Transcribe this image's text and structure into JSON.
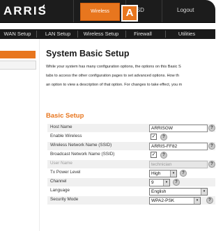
{
  "brand": {
    "logo": "ARRIS"
  },
  "top_nav": {
    "items": [
      {
        "label": "Wireless"
      },
      {
        "label": "HSD"
      },
      {
        "label": "Logout"
      }
    ],
    "active": "Wireless",
    "callout": "A"
  },
  "sub_nav": {
    "items": [
      {
        "label": "WAN Setup"
      },
      {
        "label": "LAN Setup"
      },
      {
        "label": "Wireless Setup"
      },
      {
        "label": "Firewall"
      },
      {
        "label": "Utilities"
      }
    ]
  },
  "page": {
    "title": "System Basic Setup",
    "description": [
      "While your system has many configuration options, the options on this Basic S",
      "tabs to access the other configuration pages to set advanced options. How th",
      "an option to view a description of that option. For changes to take effect, you m"
    ],
    "section": "Basic Setup"
  },
  "form": {
    "host_name": {
      "label": "Host Name",
      "value": "ARRISGW"
    },
    "enable_wireless": {
      "label": "Enable Wireless",
      "checked": true,
      "mark": "✓"
    },
    "ssid": {
      "label": "Wireless Network Name (SSID)",
      "value": "ARRIS-FF82"
    },
    "broadcast_ssid": {
      "label": "Broadcast Network Name (SSID)",
      "checked": true,
      "mark": "✓"
    },
    "user_name": {
      "label": "User Name",
      "value": "technician"
    },
    "tx_power": {
      "label": "Tx Power Level",
      "value": "High"
    },
    "channel": {
      "label": "Channel",
      "value": "9"
    },
    "language": {
      "label": "Language",
      "value": "English"
    },
    "security_mode": {
      "label": "Security Mode",
      "value": "WPA2-PSK"
    }
  },
  "help_glyph": "?",
  "dropdown_glyph": "▾",
  "colors": {
    "accent": "#e8761e",
    "topbar": "#1c1c1c"
  }
}
